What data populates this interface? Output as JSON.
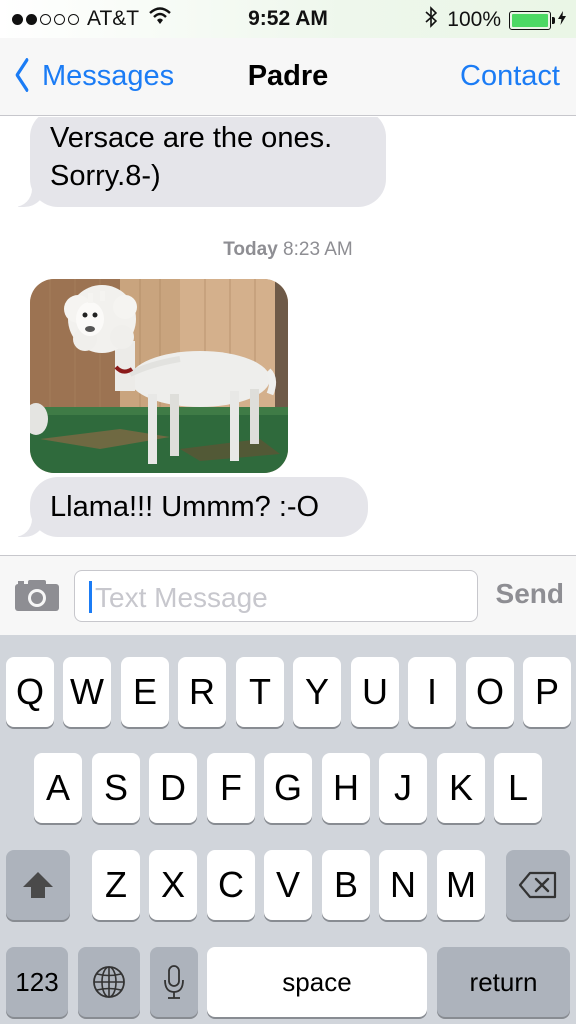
{
  "status_bar": {
    "carrier": "AT&T",
    "time": "9:52 AM",
    "battery": "100%",
    "signal_bars_filled": 2,
    "signal_bars_total": 5
  },
  "nav": {
    "back_label": "Messages",
    "title": "Padre",
    "right_label": "Contact"
  },
  "messages": [
    {
      "text_line1": "Versace are the ones.",
      "text_line2": "Sorry.8-)"
    },
    {
      "text": "Llama!!!  Ummm? :-O"
    }
  ],
  "timestamp": {
    "day": "Today",
    "time": "8:23 AM"
  },
  "composer": {
    "placeholder": "Text Message",
    "send_label": "Send"
  },
  "keyboard": {
    "row1": [
      "Q",
      "W",
      "E",
      "R",
      "T",
      "Y",
      "U",
      "I",
      "O",
      "P"
    ],
    "row2": [
      "A",
      "S",
      "D",
      "F",
      "G",
      "H",
      "J",
      "K",
      "L"
    ],
    "row3": [
      "Z",
      "X",
      "C",
      "V",
      "B",
      "N",
      "M"
    ],
    "numbers_label": "123",
    "space_label": "space",
    "return_label": "return"
  },
  "colors": {
    "accent": "#1b7cf5",
    "bubble_incoming": "#e5e5ea",
    "keyboard_bg": "#d1d5db",
    "battery_fill": "#4cd964"
  }
}
